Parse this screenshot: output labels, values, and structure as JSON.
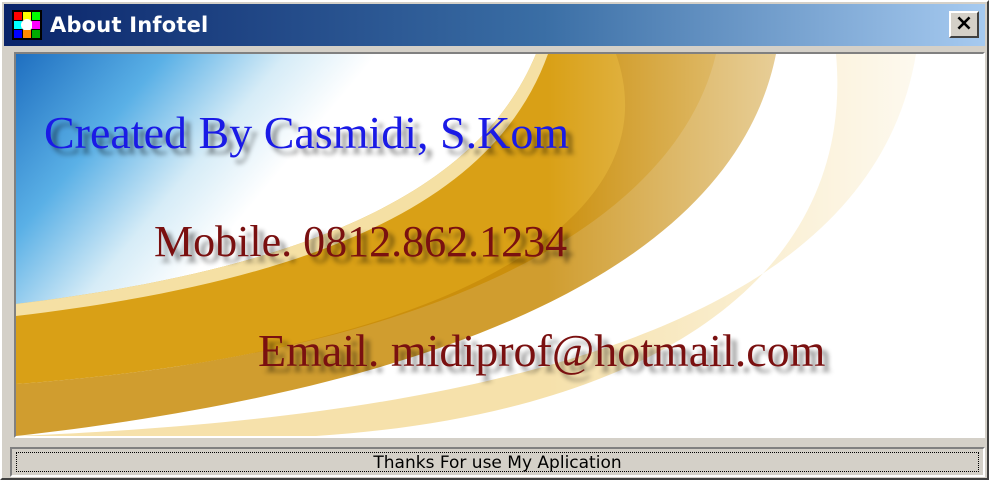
{
  "window": {
    "title": "About Infotel",
    "close_label": "×"
  },
  "banner": {
    "created_by": "Created By Casmidi, S.Kom",
    "mobile": "Mobile. 0812.862.1234",
    "email": "Email. midiprof@hotmail.com"
  },
  "status": {
    "text": "Thanks For use My Aplication"
  },
  "colors": {
    "title_gradient_start": "#0a246a",
    "title_gradient_end": "#a6caf0",
    "created_text": "#1a1ae6",
    "contact_text": "#7a1010",
    "swoosh_gold": "#d8a21a",
    "sky_blue": "#3c9ad8"
  },
  "icons": {
    "app": "app-logo-icon",
    "close": "close-icon"
  }
}
